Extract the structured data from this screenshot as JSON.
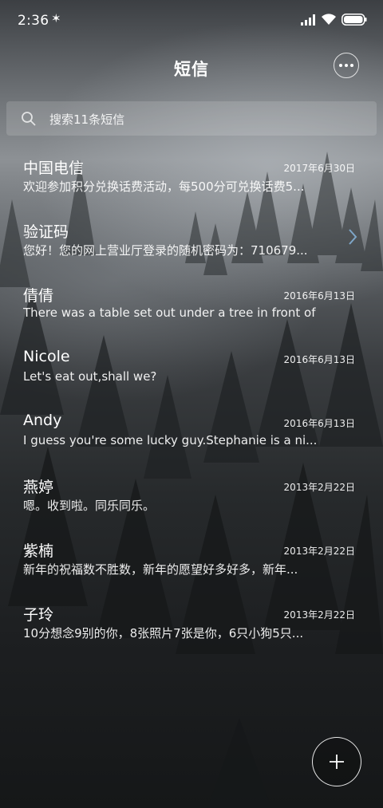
{
  "status_bar": {
    "time": "2:36",
    "bluetooth_icon": "bluetooth-icon",
    "signal_icon": "signal-icon",
    "wifi_icon": "wifi-icon",
    "battery_icon": "battery-icon"
  },
  "header": {
    "title": "短信",
    "more_icon": "more-icon"
  },
  "search": {
    "placeholder": "搜索11条短信",
    "icon": "search-icon"
  },
  "conversations": [
    {
      "name": "中国电信",
      "date": "2017年6月30日",
      "preview": "欢迎参加积分兑换话费活动，每500分可兑换话费5..."
    },
    {
      "name": "验证码",
      "date": "",
      "preview": "您好！您的网上营业厅登录的随机密码为：710679..."
    },
    {
      "name": "倩倩",
      "date": "2016年6月13日",
      "preview": "There was a table set out under a tree in front of ..."
    },
    {
      "name": "Nicole",
      "date": "2016年6月13日",
      "preview": "Let's eat out,shall we?"
    },
    {
      "name": "Andy",
      "date": "2016年6月13日",
      "preview": "I guess you're some lucky guy.Stephanie is a ni..."
    },
    {
      "name": "燕婷",
      "date": "2013年2月22日",
      "preview": "嗯。收到啦。同乐同乐。"
    },
    {
      "name": "紫楠",
      "date": "2013年2月22日",
      "preview": "新年的祝福数不胜数，新年的愿望好多好多，新年..."
    },
    {
      "name": "子玲",
      "date": "2013年2月22日",
      "preview": "10分想念9别的你，8张照片7张是你，6只小狗5只..."
    }
  ],
  "compose": {
    "icon": "plus-icon"
  },
  "colors": {
    "text": "#ffffff",
    "accent_chevron": "#7ea6c8"
  }
}
